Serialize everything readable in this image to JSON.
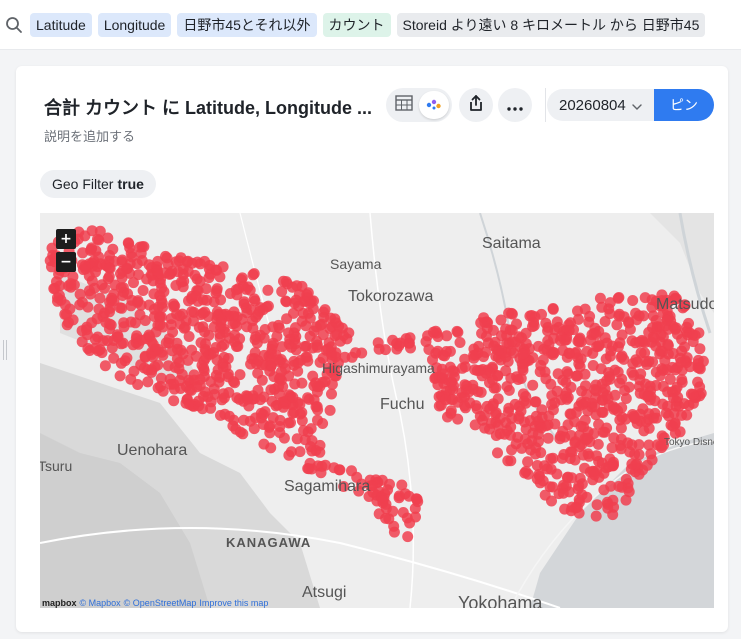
{
  "search": {
    "chips": [
      {
        "label": "Latitude",
        "color": "blue"
      },
      {
        "label": "Longitude",
        "color": "blue"
      },
      {
        "label": "日野市45とそれ以外",
        "color": "blue"
      },
      {
        "label": "カウント",
        "color": "green"
      },
      {
        "label": "Storeid より遠い 8 キロメートル から 日野市45",
        "color": "gray"
      }
    ]
  },
  "card": {
    "title": "合計 カウント に Latitude, Longitude ...",
    "subtitle": "説明を追加する",
    "date_value": "20260804",
    "pin_label": "ピン",
    "geo_filter_label": "Geo Filter",
    "geo_filter_value": "true"
  },
  "map": {
    "point_color": "#f0404f",
    "place_labels": [
      "Saitama",
      "Sayama",
      "Tokorozawa",
      "Matsudo",
      "Higashimurayama",
      "Fuchu",
      "Uenohara",
      "Tsuru",
      "Sagamihara",
      "KANAGAWA",
      "Atsugi",
      "Yokohama",
      "Tokyo Disney Land"
    ],
    "zoom_in": "+",
    "zoom_out": "−",
    "attribution": {
      "logo": "mapbox",
      "copyright_mapbox": "© Mapbox",
      "copyright_osm": "© OpenStreetMap",
      "improve": "Improve this map"
    }
  },
  "icons": {
    "search": "search-icon",
    "table": "table-icon",
    "map_view": "map-view-icon",
    "share": "share-icon",
    "more": "more-icon",
    "chevron": "chevron-down-icon"
  }
}
